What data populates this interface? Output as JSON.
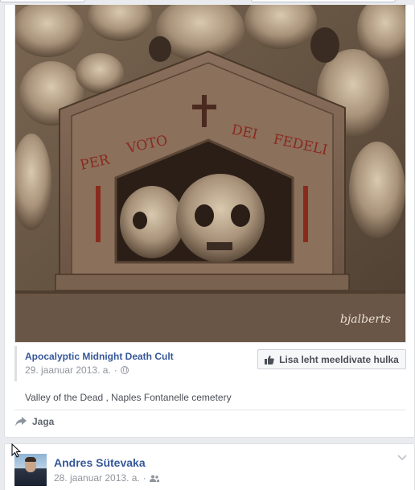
{
  "shared_post": {
    "image": {
      "alt": "Ossuary niche with skulls",
      "inscription": "PER VOTO DEI FEDELI",
      "watermark": "bjalberts"
    },
    "page_title": "Apocalyptic Midnight Death Cult",
    "date": "29. jaanuar 2013. a.",
    "meta_separator": "·",
    "privacy_icon": "globe-icon",
    "like_page_button": "Lisa leht meeldivate hulka",
    "description": "Valley of the Dead , Naples Fontanelle cemetery",
    "share_label": "Jaga"
  },
  "next_post": {
    "author": "Andres Sütevaka",
    "date": "28. jaanuar 2013. a.",
    "meta_separator": "·",
    "privacy_icon": "friends-icon",
    "menu_icon": "chevron-down-icon"
  },
  "colors": {
    "link_blue": "#365899",
    "meta_gray": "#90949c",
    "background": "#e9ebee"
  }
}
